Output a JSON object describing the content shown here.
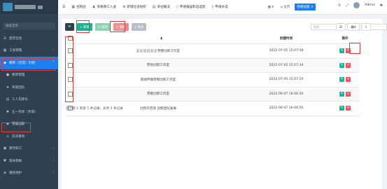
{
  "sidebar": {
    "search_placeholder": "搜索菜单",
    "items": [
      {
        "label": "首页信息",
        "icon": "list-icon"
      },
      {
        "label": "工会管理",
        "icon": "building-icon"
      },
      {
        "label": "教师（示范）引领",
        "icon": "graduation-cap-icon"
      },
      {
        "label": "教师管理",
        "icon": "user-icon"
      },
      {
        "label": "荣誉团队",
        "icon": "star-icon"
      },
      {
        "label": "工人先锋号",
        "icon": "book-icon"
      },
      {
        "label": "五一奖状（奖章）",
        "icon": "medal-icon"
      },
      {
        "label": "劳模创新",
        "icon": "lightbulb-icon"
      },
      {
        "label": "实训基地",
        "icon": "home-icon"
      },
      {
        "label": "服务职工",
        "icon": "users-icon"
      },
      {
        "label": "帮扶救助",
        "icon": "heart-icon"
      },
      {
        "label": "维权保护",
        "icon": "shield-icon"
      }
    ]
  },
  "topbar": {
    "menu_icon": "hamburger-icon",
    "nav": [
      {
        "label": "控制台",
        "icon": "dashboard-icon"
      },
      {
        "label": "资格政工入会",
        "icon": "user-plus-icon"
      },
      {
        "label": "新增社会组织",
        "icon": "plus-circle-icon"
      },
      {
        "label": "单位概况",
        "icon": "grid-icon"
      },
      {
        "label": "申请报届和选选到",
        "icon": "file-icon"
      },
      {
        "label": "申请补选",
        "icon": "file-icon"
      }
    ],
    "tabs": [
      "主页",
      "劳模创新"
    ],
    "user": "Admin"
  },
  "toolbar": {
    "refresh_icon": "refresh-icon",
    "add": "+ 新增",
    "edit": "✎ 修改",
    "delete": "✕ 删除",
    "more": "⇩ 更多"
  },
  "search": {
    "placeholder": "搜索"
  },
  "table": {
    "headers": {
      "name": "名称",
      "created": "创建时间",
      "ops": "操作"
    },
    "rows": [
      {
        "name": "劳模创新工作室",
        "created": "2022-07-05 15:07:48"
      },
      {
        "name": "劳动创新工作室",
        "created": "2022-07-05 15:07:34"
      },
      {
        "name": "新闻传播劳模创新工作室",
        "created": "2022-07-05 15:07:20"
      },
      {
        "name": "劳模创新工作室",
        "created": "2022-06-07 16:06:56"
      },
      {
        "name": "创新示范岗 创新团队发展",
        "created": "2022-06-07 16:06:56"
      }
    ]
  },
  "footer": {
    "summary": "显示第 1 到第 5 条记录，总共 5 条记录"
  },
  "colors": {
    "sidebar_bg": "#2f4050",
    "primary": "#1c7ff0",
    "success": "#1ab394",
    "danger": "#ed5565",
    "highlight": "#e53935"
  }
}
